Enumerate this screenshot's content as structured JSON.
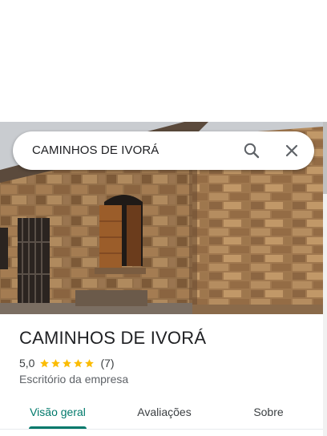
{
  "search": {
    "query": "CAMINHOS DE IVORÁ",
    "search_icon": "search-icon",
    "close_icon": "close-icon"
  },
  "place": {
    "photo": "building-photo",
    "title": "CAMINHOS DE IVORÁ",
    "rating": "5,0",
    "rating_stars": 5,
    "review_count": "(7)",
    "category": "Escritório da empresa",
    "star_color": "#fbbc04"
  },
  "tabs": [
    {
      "label": "Visão geral",
      "active": true
    },
    {
      "label": "Avaliações",
      "active": false
    },
    {
      "label": "Sobre",
      "active": false
    }
  ],
  "accent_color": "#00796b"
}
